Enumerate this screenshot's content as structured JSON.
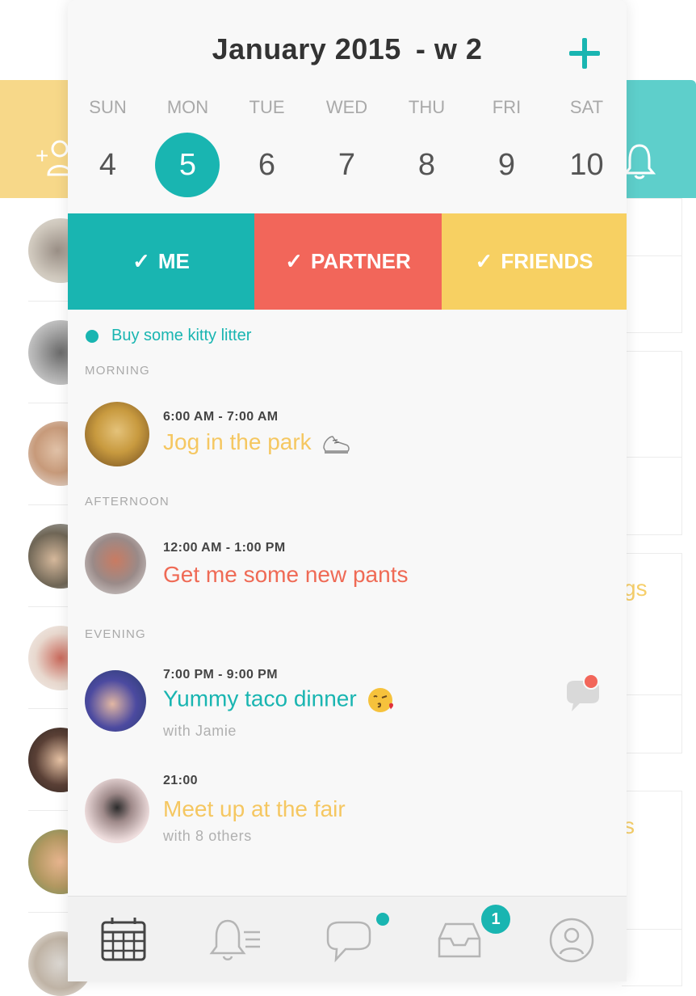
{
  "header": {
    "month": "January 2015",
    "week": "- w 2",
    "add_icon": "plus-icon"
  },
  "weekdays": [
    "SUN",
    "MON",
    "TUE",
    "WED",
    "THU",
    "FRI",
    "SAT"
  ],
  "days": [
    "4",
    "5",
    "6",
    "7",
    "8",
    "9",
    "10"
  ],
  "selected_day": "5",
  "filters": [
    {
      "label": "ME",
      "color": "#19b5b1",
      "check": "✓"
    },
    {
      "label": "PARTNER",
      "color": "#f2665a",
      "check": "✓"
    },
    {
      "label": "FRIENDS",
      "color": "#f7d062",
      "check": "✓"
    }
  ],
  "todo": {
    "text": "Buy some kitty litter",
    "color": "#19b5b1"
  },
  "sections": {
    "morning": "MORNING",
    "afternoon": "AFTERNOON",
    "evening": "EVENING"
  },
  "events": [
    {
      "time": "6:00 AM - 7:00 AM",
      "title": "Jog in the park",
      "with": "",
      "color": "#f5c761",
      "emoji": "running-shoe"
    },
    {
      "time": "12:00 AM - 1:00 PM",
      "title": "Get me some new pants",
      "with": "",
      "color": "#ef6a55",
      "emoji": ""
    },
    {
      "time": "7:00 PM - 9:00 PM",
      "title": "Yummy taco dinner",
      "with": "with Jamie",
      "color": "#19b5b1",
      "emoji": "face-blowing-kiss"
    },
    {
      "time": "21:00",
      "title": "Meet up at the fair",
      "with": "with 8 others",
      "color": "#f5c761",
      "emoji": ""
    }
  ],
  "tabbar": {
    "tabs": [
      "calendar-icon",
      "notifications-list-icon",
      "chat-icon",
      "inbox-icon",
      "profile-icon"
    ],
    "inbox_badge": "1",
    "accent": "#19b5b1"
  },
  "background": {
    "left_color": "#f7d889",
    "right_color": "#5ecfcb",
    "right_words": [
      "gs",
      "s"
    ]
  }
}
